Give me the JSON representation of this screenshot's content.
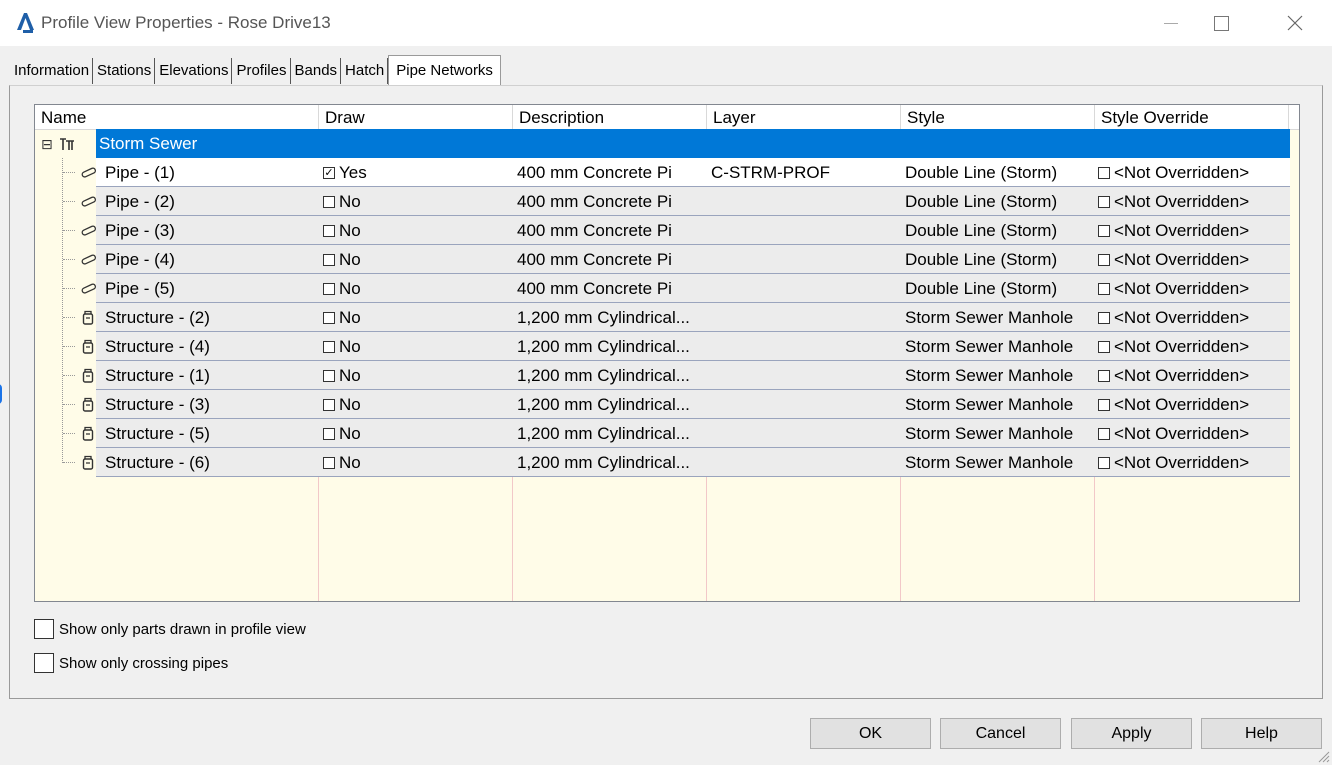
{
  "window": {
    "title": "Profile View Properties - Rose Drive13",
    "logo_icon": "autocad-civil3d-logo",
    "controls": {
      "minimize": "—",
      "maximize": "☐",
      "close": "✕"
    }
  },
  "tabs": [
    {
      "label": "Information",
      "active": false
    },
    {
      "label": "Stations",
      "active": false
    },
    {
      "label": "Elevations",
      "active": false
    },
    {
      "label": "Profiles",
      "active": false
    },
    {
      "label": "Bands",
      "active": false
    },
    {
      "label": "Hatch",
      "active": false
    },
    {
      "label": "Pipe Networks",
      "active": true
    }
  ],
  "grid": {
    "columns": [
      "Name",
      "Draw",
      "Description",
      "Layer",
      "Style",
      "Style Override"
    ],
    "network": {
      "name": "Storm Sewer",
      "expand_icon": "⊟",
      "icon": "pipe-network-icon"
    },
    "rows": [
      {
        "name": "Pipe - (1)",
        "icon": "pipe-icon",
        "draw": "Yes",
        "checked": true,
        "description": "400 mm Concrete Pi",
        "layer": "C-STRM-PROF",
        "style": "Double Line (Storm)",
        "override": "<Not Overridden>"
      },
      {
        "name": "Pipe - (2)",
        "icon": "pipe-icon",
        "draw": "No",
        "checked": false,
        "description": "400 mm Concrete Pi",
        "layer": "",
        "style": "Double Line (Storm)",
        "override": "<Not Overridden>"
      },
      {
        "name": "Pipe - (3)",
        "icon": "pipe-icon",
        "draw": "No",
        "checked": false,
        "description": "400 mm Concrete Pi",
        "layer": "",
        "style": "Double Line (Storm)",
        "override": "<Not Overridden>"
      },
      {
        "name": "Pipe - (4)",
        "icon": "pipe-icon",
        "draw": "No",
        "checked": false,
        "description": "400 mm Concrete Pi",
        "layer": "",
        "style": "Double Line (Storm)",
        "override": "<Not Overridden>"
      },
      {
        "name": "Pipe - (5)",
        "icon": "pipe-icon",
        "draw": "No",
        "checked": false,
        "description": "400 mm Concrete Pi",
        "layer": "",
        "style": "Double Line (Storm)",
        "override": "<Not Overridden>"
      },
      {
        "name": "Structure - (2)",
        "icon": "structure-icon",
        "draw": "No",
        "checked": false,
        "description": "1,200 mm Cylindrical...",
        "layer": "",
        "style": "Storm Sewer Manhole",
        "override": "<Not Overridden>"
      },
      {
        "name": "Structure - (4)",
        "icon": "structure-icon",
        "draw": "No",
        "checked": false,
        "description": "1,200 mm Cylindrical...",
        "layer": "",
        "style": "Storm Sewer Manhole",
        "override": "<Not Overridden>"
      },
      {
        "name": "Structure - (1)",
        "icon": "structure-icon",
        "draw": "No",
        "checked": false,
        "description": "1,200 mm Cylindrical...",
        "layer": "",
        "style": "Storm Sewer Manhole",
        "override": "<Not Overridden>"
      },
      {
        "name": "Structure - (3)",
        "icon": "structure-icon",
        "draw": "No",
        "checked": false,
        "description": "1,200 mm Cylindrical...",
        "layer": "",
        "style": "Storm Sewer Manhole",
        "override": "<Not Overridden>"
      },
      {
        "name": "Structure - (5)",
        "icon": "structure-icon",
        "draw": "No",
        "checked": false,
        "description": "1,200 mm Cylindrical...",
        "layer": "",
        "style": "Storm Sewer Manhole",
        "override": "<Not Overridden>"
      },
      {
        "name": "Structure - (6)",
        "icon": "structure-icon",
        "draw": "No",
        "checked": false,
        "description": "1,200 mm Cylindrical...",
        "layer": "",
        "style": "Storm Sewer Manhole",
        "override": "<Not Overridden>"
      }
    ]
  },
  "options": {
    "show_only_drawn": "Show only parts drawn in profile view",
    "show_only_crossing": "Show only crossing pipes"
  },
  "buttons": {
    "ok": "OK",
    "cancel": "Cancel",
    "apply": "Apply",
    "help": "Help"
  },
  "colors": {
    "selection": "#0078d7",
    "grid_background": "#fffce8"
  }
}
